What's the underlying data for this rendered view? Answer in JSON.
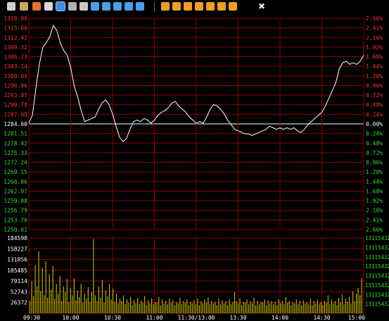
{
  "toolbar": {
    "buttons": [
      {
        "icon": "cursor-icon",
        "color": "#cfcfcf"
      },
      {
        "icon": "hand-icon",
        "color": "#d0a060"
      },
      {
        "icon": "refresh-icon",
        "color": "#e07030"
      },
      {
        "icon": "document-icon",
        "color": "#d8d8d8"
      },
      {
        "icon": "line-chart-icon",
        "color": "#3a8ee6",
        "toggled": true
      },
      {
        "icon": "network-icon",
        "color": "#b0b0b0"
      },
      {
        "icon": "mail-icon",
        "color": "#c8c8c8"
      },
      {
        "icon": "grid-icon",
        "color": "#4aa0e8"
      },
      {
        "icon": "table-icon",
        "color": "#4aa0e8"
      },
      {
        "icon": "list-icon",
        "color": "#4aa0e8"
      },
      {
        "icon": "layers-icon",
        "color": "#4aa0e8"
      },
      {
        "icon": "crossed-grid-icon",
        "color": "#4aa0e8"
      },
      {
        "icon": "up-arrow-box-icon",
        "color": "#f0a020"
      },
      {
        "icon": "down-arrow-box-icon",
        "color": "#f0a020"
      },
      {
        "icon": "left-arrow-box-icon",
        "color": "#f0a020"
      },
      {
        "icon": "right-arrow-box-icon",
        "color": "#f0a020"
      },
      {
        "icon": "zoom-in-box-icon",
        "color": "#f0a020"
      },
      {
        "icon": "zoom-out-box-icon",
        "color": "#f0a020"
      },
      {
        "icon": "pencil-box-icon",
        "color": "#f0a020"
      },
      {
        "icon": "close-icon",
        "color": "#e0e0e0"
      }
    ]
  },
  "chart_data": {
    "type": "line",
    "price_axis": {
      "ticks": [
        "1318.89",
        "1315.60",
        "1312.42",
        "1309.32",
        "1306.23",
        "1303.14",
        "1300.05",
        "1296.96",
        "1293.87",
        "1290.78",
        "1287.69",
        "1284.60",
        "1281.51",
        "1278.42",
        "1275.33",
        "1272.24",
        "1269.15",
        "1266.06",
        "1262.97",
        "1259.88",
        "1256.79",
        "1253.70",
        "1250.61"
      ],
      "base": "1284.60",
      "ylim": [
        1250.61,
        1318.89
      ]
    },
    "percent_axis": {
      "ticks": [
        "2.66%",
        "2.41%",
        "2.16%",
        "1.92%",
        "1.68%",
        "1.44%",
        "1.20%",
        "0.96%",
        "0.72%",
        "0.48%",
        "0.24%",
        "0.00%",
        "0.24%",
        "0.48%",
        "0.72%",
        "0.96%",
        "1.20%",
        "1.44%",
        "1.68%",
        "1.92%",
        "2.16%",
        "2.41%",
        "2.66%"
      ]
    },
    "volume_axis": {
      "ticks": [
        "184598",
        "158227",
        "131856",
        "105485",
        "79114",
        "52743",
        "26372"
      ],
      "right_ticks": [
        "13115432",
        "13115432",
        "13115432",
        "13115432",
        "13115432",
        "13115432",
        "13115432",
        "13115432"
      ],
      "ylim": [
        0,
        184598
      ]
    },
    "x_labels": [
      "09:30",
      "10:00",
      "10:30",
      "11:00",
      "11:30/13:00",
      "13:30",
      "14:00",
      "14:30",
      "15:00"
    ],
    "colors": {
      "up": "#ff3030",
      "down": "#33dd33",
      "grid": "#8b0000",
      "line": "#ffffff",
      "volume": "#b5b000",
      "base_label": "#ffffff"
    },
    "price_series": [
      {
        "t": 0,
        "v": 1285.0
      },
      {
        "t": 2,
        "v": 1287.5
      },
      {
        "t": 4,
        "v": 1296.0
      },
      {
        "t": 6,
        "v": 1304.0
      },
      {
        "t": 8,
        "v": 1309.5
      },
      {
        "t": 10,
        "v": 1311.0
      },
      {
        "t": 12,
        "v": 1313.0
      },
      {
        "t": 14,
        "v": 1316.5
      },
      {
        "t": 16,
        "v": 1315.0
      },
      {
        "t": 18,
        "v": 1311.0
      },
      {
        "t": 20,
        "v": 1308.5
      },
      {
        "t": 22,
        "v": 1307.0
      },
      {
        "t": 24,
        "v": 1303.0
      },
      {
        "t": 26,
        "v": 1297.0
      },
      {
        "t": 28,
        "v": 1293.5
      },
      {
        "t": 30,
        "v": 1289.0
      },
      {
        "t": 32,
        "v": 1285.5
      },
      {
        "t": 34,
        "v": 1286.0
      },
      {
        "t": 36,
        "v": 1286.5
      },
      {
        "t": 38,
        "v": 1287.0
      },
      {
        "t": 40,
        "v": 1289.5
      },
      {
        "t": 42,
        "v": 1291.5
      },
      {
        "t": 44,
        "v": 1292.5
      },
      {
        "t": 46,
        "v": 1291.0
      },
      {
        "t": 48,
        "v": 1288.0
      },
      {
        "t": 50,
        "v": 1284.0
      },
      {
        "t": 52,
        "v": 1280.5
      },
      {
        "t": 54,
        "v": 1279.0
      },
      {
        "t": 56,
        "v": 1280.0
      },
      {
        "t": 58,
        "v": 1283.0
      },
      {
        "t": 60,
        "v": 1285.5
      },
      {
        "t": 62,
        "v": 1286.0
      },
      {
        "t": 64,
        "v": 1285.5
      },
      {
        "t": 66,
        "v": 1286.5
      },
      {
        "t": 68,
        "v": 1286.0
      },
      {
        "t": 70,
        "v": 1285.0
      },
      {
        "t": 72,
        "v": 1286.0
      },
      {
        "t": 74,
        "v": 1287.5
      },
      {
        "t": 76,
        "v": 1288.5
      },
      {
        "t": 78,
        "v": 1289.0
      },
      {
        "t": 80,
        "v": 1290.0
      },
      {
        "t": 82,
        "v": 1291.5
      },
      {
        "t": 84,
        "v": 1292.0
      },
      {
        "t": 86,
        "v": 1290.5
      },
      {
        "t": 88,
        "v": 1289.5
      },
      {
        "t": 90,
        "v": 1288.5
      },
      {
        "t": 92,
        "v": 1287.0
      },
      {
        "t": 94,
        "v": 1286.0
      },
      {
        "t": 96,
        "v": 1285.0
      },
      {
        "t": 98,
        "v": 1285.5
      },
      {
        "t": 100,
        "v": 1285.0
      },
      {
        "t": 102,
        "v": 1287.0
      },
      {
        "t": 104,
        "v": 1289.5
      },
      {
        "t": 106,
        "v": 1291.0
      },
      {
        "t": 108,
        "v": 1290.5
      },
      {
        "t": 110,
        "v": 1289.5
      },
      {
        "t": 112,
        "v": 1288.0
      },
      {
        "t": 114,
        "v": 1286.0
      },
      {
        "t": 116,
        "v": 1284.5
      },
      {
        "t": 118,
        "v": 1283.0
      },
      {
        "t": 120,
        "v": 1282.5
      },
      {
        "t": 122,
        "v": 1282.0
      },
      {
        "t": 124,
        "v": 1281.5
      },
      {
        "t": 126,
        "v": 1281.5
      },
      {
        "t": 128,
        "v": 1281.0
      },
      {
        "t": 130,
        "v": 1281.5
      },
      {
        "t": 132,
        "v": 1282.0
      },
      {
        "t": 134,
        "v": 1282.5
      },
      {
        "t": 136,
        "v": 1283.0
      },
      {
        "t": 138,
        "v": 1284.0
      },
      {
        "t": 140,
        "v": 1283.5
      },
      {
        "t": 142,
        "v": 1283.0
      },
      {
        "t": 144,
        "v": 1283.5
      },
      {
        "t": 146,
        "v": 1283.0
      },
      {
        "t": 148,
        "v": 1283.5
      },
      {
        "t": 150,
        "v": 1283.0
      },
      {
        "t": 152,
        "v": 1283.5
      },
      {
        "t": 154,
        "v": 1282.5
      },
      {
        "t": 156,
        "v": 1282.0
      },
      {
        "t": 158,
        "v": 1283.0
      },
      {
        "t": 160,
        "v": 1284.5
      },
      {
        "t": 162,
        "v": 1285.5
      },
      {
        "t": 164,
        "v": 1286.5
      },
      {
        "t": 166,
        "v": 1287.5
      },
      {
        "t": 168,
        "v": 1288.5
      },
      {
        "t": 170,
        "v": 1290.5
      },
      {
        "t": 172,
        "v": 1293.0
      },
      {
        "t": 174,
        "v": 1295.5
      },
      {
        "t": 176,
        "v": 1298.0
      },
      {
        "t": 178,
        "v": 1302.5
      },
      {
        "t": 180,
        "v": 1304.5
      },
      {
        "t": 182,
        "v": 1305.0
      },
      {
        "t": 184,
        "v": 1304.0
      },
      {
        "t": 186,
        "v": 1304.5
      },
      {
        "t": 188,
        "v": 1304.0
      },
      {
        "t": 190,
        "v": 1305.0
      },
      {
        "t": 192,
        "v": 1307.0
      }
    ],
    "volumes": [
      30000,
      78000,
      42000,
      118000,
      66000,
      152000,
      54000,
      112000,
      44000,
      128000,
      38000,
      96000,
      58000,
      116000,
      36000,
      72000,
      48000,
      92000,
      30000,
      66000,
      52000,
      84000,
      28000,
      62000,
      44000,
      86000,
      32000,
      56000,
      40000,
      72000,
      26000,
      48000,
      36000,
      64000,
      28000,
      52000,
      182000,
      44000,
      30000,
      66000,
      38000,
      82000,
      26000,
      56000,
      42000,
      72000,
      34000,
      60000,
      28000,
      48000,
      24000,
      36000,
      30000,
      44000,
      22000,
      34000,
      26000,
      40000,
      20000,
      32000,
      24000,
      38000,
      22000,
      30000,
      26000,
      42000,
      20000,
      32000,
      24000,
      36000,
      22000,
      28000,
      26000,
      40000,
      20000,
      34000,
      24000,
      30000,
      22000,
      36000,
      26000,
      32000,
      20000,
      28000,
      24000,
      38000,
      22000,
      30000,
      26000,
      34000,
      20000,
      28000,
      24000,
      32000,
      22000,
      36000,
      20000,
      30000,
      24000,
      34000,
      26000,
      40000,
      22000,
      30000,
      24000,
      28000,
      20000,
      36000,
      22000,
      32000,
      24000,
      30000,
      20000,
      34000,
      22000,
      28000,
      52000,
      30000,
      24000,
      36000,
      20000,
      28000,
      26000,
      34000,
      22000,
      30000,
      24000,
      38000,
      20000,
      30000,
      22000,
      28000,
      26000,
      34000,
      20000,
      32000,
      24000,
      30000,
      22000,
      28000,
      20000,
      34000,
      24000,
      30000,
      22000,
      40000,
      26000,
      30000,
      20000,
      28000,
      24000,
      34000,
      22000,
      30000,
      20000,
      32000,
      24000,
      28000,
      22000,
      36000,
      20000,
      30000,
      24000,
      34000,
      22000,
      28000,
      20000,
      30000,
      26000,
      44000,
      22000,
      34000,
      24000,
      30000,
      20000,
      38000,
      26000,
      46000,
      22000,
      36000,
      28000,
      40000,
      24000,
      54000,
      30000,
      48000,
      62000,
      44000,
      86000
    ]
  }
}
